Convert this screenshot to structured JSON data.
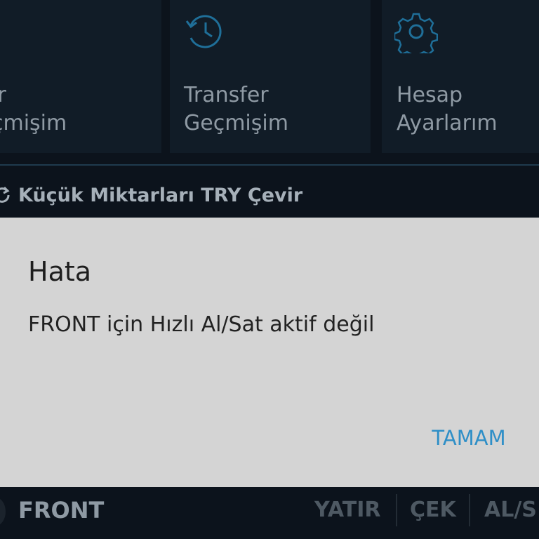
{
  "tiles": [
    {
      "label": "ir\nçmişim",
      "icon": "document-icon"
    },
    {
      "label": "Transfer\nGeçmişim",
      "icon": "history-icon"
    },
    {
      "label": "Hesap\nAyarlarım",
      "icon": "gear-icon"
    }
  ],
  "convert": {
    "label": "Küçük Miktarları TRY Çevir",
    "icon": "refresh-icon"
  },
  "dialog": {
    "title": "Hata",
    "message": "FRONT için Hızlı Al/Sat aktif değil",
    "ok_label": "TAMAM"
  },
  "bottom_bar": {
    "coin": "FRONT",
    "actions": [
      "YATIR",
      "ÇEK",
      "AL/S"
    ]
  },
  "colors": {
    "background": "#0c131c",
    "tile": "#111c27",
    "dialog": "#d4d4d4",
    "accent": "#2f8fc7"
  }
}
